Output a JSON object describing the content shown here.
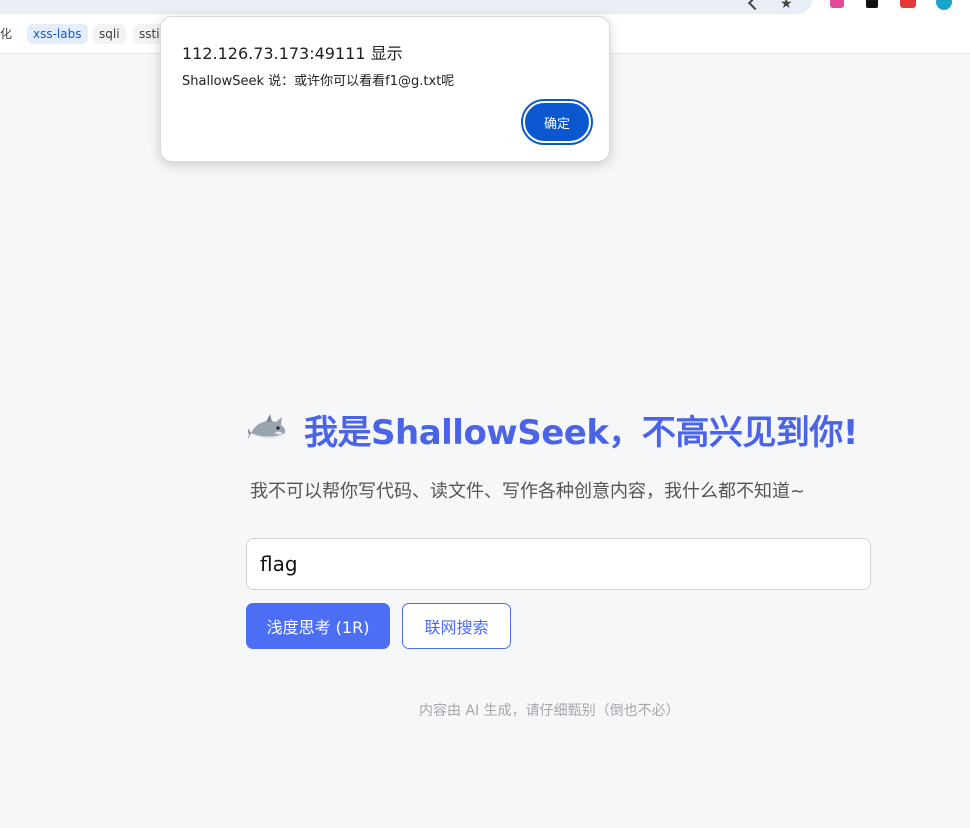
{
  "bookmarks": [
    {
      "label": "化"
    },
    {
      "label": "xss-labs"
    },
    {
      "label": "sqli"
    },
    {
      "label": "ssti"
    }
  ],
  "alert": {
    "origin": "112.126.73.173:49111 显示",
    "message": "ShallowSeek 说：或许你可以看看f1@g.txt呢",
    "ok_label": "确定"
  },
  "main": {
    "title": "我是ShallowSeek，不高兴见到你!",
    "subtitle": "我不可以帮你写代码、读文件、写作各种创意内容，我什么都不知道~",
    "search_value": "flag",
    "deep_think_label": "浅度思考 (1R)",
    "web_search_label": "联网搜索",
    "footnote": "内容由 AI 生成，请仔细甄别（倒也不必）"
  },
  "icons": {
    "logo": "shark-icon",
    "toolbar": [
      "share-icon",
      "star-icon",
      "extension-icon",
      "extension-icon",
      "extension-icon",
      "profile-icon"
    ]
  },
  "colors": {
    "accent": "#4c6ef5",
    "title": "#4a63e7",
    "dialog_button": "#0b57d0"
  }
}
